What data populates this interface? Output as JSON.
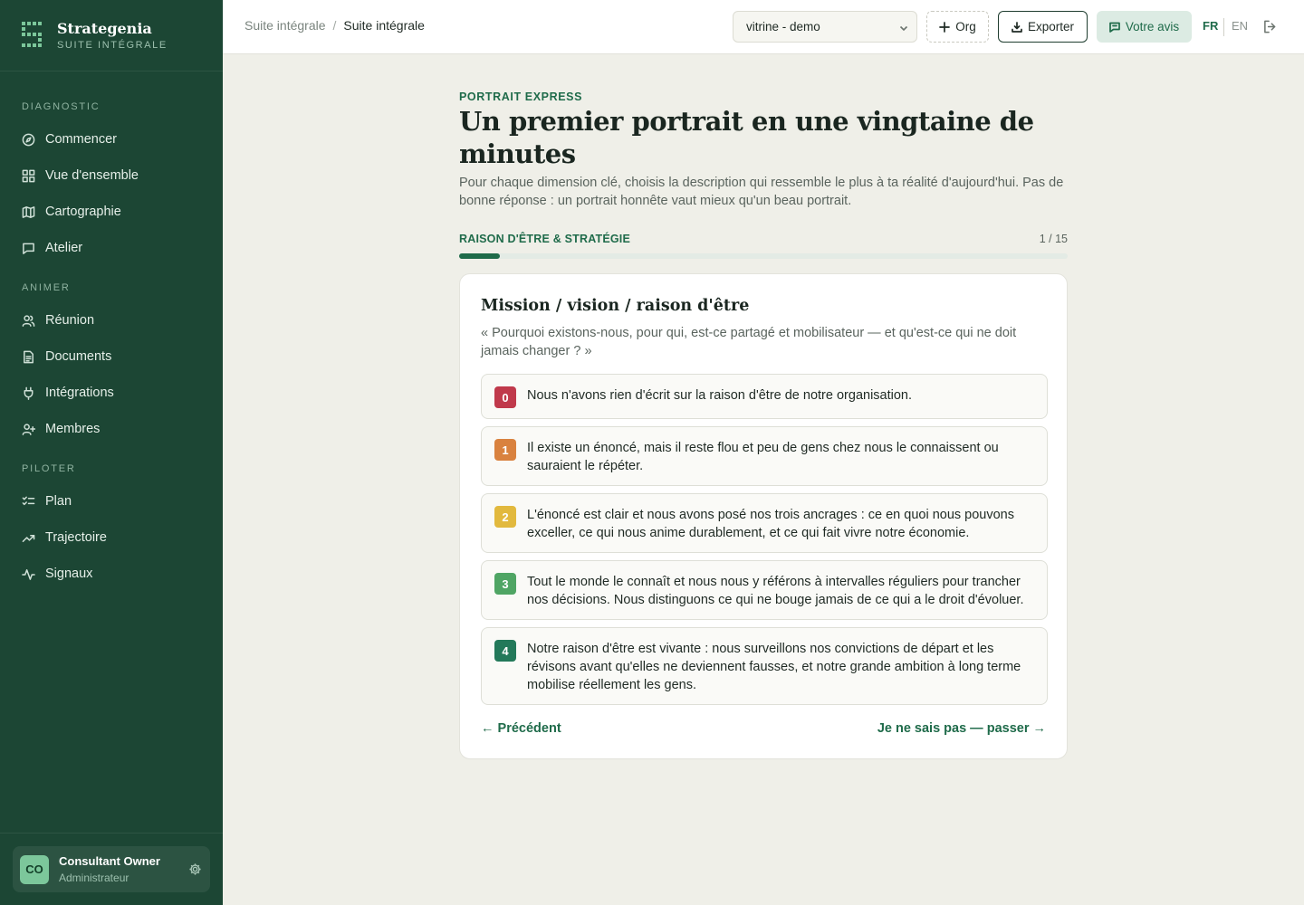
{
  "brand": {
    "name": "Strategenia",
    "subtitle": "SUITE INTÉGRALE"
  },
  "sidebar": {
    "sections": [
      {
        "label": "DIAGNOSTIC",
        "items": [
          {
            "label": "Commencer",
            "icon": "compass-icon"
          },
          {
            "label": "Vue d'ensemble",
            "icon": "grid-icon"
          },
          {
            "label": "Cartographie",
            "icon": "map-icon"
          },
          {
            "label": "Atelier",
            "icon": "chat-icon"
          }
        ]
      },
      {
        "label": "ANIMER",
        "items": [
          {
            "label": "Réunion",
            "icon": "users-icon"
          },
          {
            "label": "Documents",
            "icon": "document-icon"
          },
          {
            "label": "Intégrations",
            "icon": "plug-icon"
          },
          {
            "label": "Membres",
            "icon": "user-plus-icon"
          }
        ]
      },
      {
        "label": "PILOTER",
        "items": [
          {
            "label": "Plan",
            "icon": "checklist-icon"
          },
          {
            "label": "Trajectoire",
            "icon": "trend-icon"
          },
          {
            "label": "Signaux",
            "icon": "pulse-icon"
          }
        ]
      }
    ],
    "user": {
      "initials": "CO",
      "name": "Consultant Owner",
      "role": "Administrateur"
    }
  },
  "header": {
    "breadcrumb": [
      "Suite intégrale",
      "Suite intégrale"
    ],
    "org_select": "vitrine - demo",
    "org_button": "Org",
    "export_button": "Exporter",
    "feedback_button": "Votre avis",
    "lang_fr": "FR",
    "lang_en": "EN"
  },
  "main": {
    "eyebrow": "PORTRAIT EXPRESS",
    "title": "Un premier portrait en une vingtaine de minutes",
    "intro": "Pour chaque dimension clé, choisis la description qui ressemble le plus à ta réalité d'aujourd'hui. Pas de bonne réponse : un portrait honnête vaut mieux qu'un beau portrait.",
    "dimension": "RAISON D'ÊTRE & STRATÉGIE",
    "step": "1 / 15",
    "progress": 0.0667,
    "card": {
      "title": "Mission / vision / raison d'être",
      "question": "« Pourquoi existons-nous, pour qui, est-ce partagé et mobilisateur — et qu'est-ce qui ne doit jamais changer ? »",
      "options": [
        {
          "level": "0",
          "color": "#c0394b",
          "text": "Nous n'avons rien d'écrit sur la raison d'être de notre organisation."
        },
        {
          "level": "1",
          "color": "#d9823f",
          "text": "Il existe un énoncé, mais il reste flou et peu de gens chez nous le connaissent ou sauraient le répéter."
        },
        {
          "level": "2",
          "color": "#e2b93e",
          "text": "L'énoncé est clair et nous avons posé nos trois ancrages : ce en quoi nous pouvons exceller, ce qui nous anime durablement, et ce qui fait vivre notre économie."
        },
        {
          "level": "3",
          "color": "#4fa564",
          "text": "Tout le monde le connaît et nous nous y référons à intervalles réguliers pour trancher nos décisions. Nous distinguons ce qui ne bouge jamais de ce qui a le droit d'évoluer."
        },
        {
          "level": "4",
          "color": "#23795a",
          "text": "Notre raison d'être est vivante : nous surveillons nos convictions de départ et les révisons avant qu'elles ne deviennent fausses, et notre grande ambition à long terme mobilise réellement les gens."
        }
      ],
      "prev": "← Précédent",
      "skip": "Je ne sais pas — passer →"
    }
  }
}
